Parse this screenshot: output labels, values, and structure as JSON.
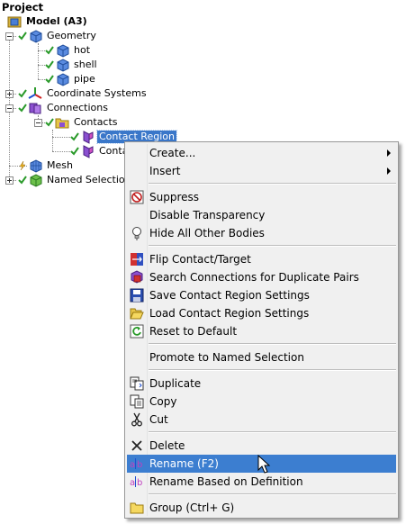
{
  "tree": {
    "title": "Project",
    "nodes": [
      {
        "label": "Model (A3)",
        "icon": "model-icon"
      },
      {
        "label": "Geometry",
        "icon": "geometry-icon"
      },
      {
        "label": "hot",
        "icon": "body-icon"
      },
      {
        "label": "shell",
        "icon": "body-icon"
      },
      {
        "label": "pipe",
        "icon": "body-icon"
      },
      {
        "label": "Coordinate Systems",
        "icon": "coordinate-systems-icon"
      },
      {
        "label": "Connections",
        "icon": "connections-icon"
      },
      {
        "label": "Contacts",
        "icon": "contacts-folder-icon"
      },
      {
        "label": "Contact Region",
        "icon": "contact-region-icon"
      },
      {
        "label": "Contac",
        "icon": "contact-region-icon"
      },
      {
        "label": "Mesh",
        "icon": "mesh-icon"
      },
      {
        "label": "Named Selections",
        "icon": "named-selections-icon"
      }
    ]
  },
  "context_menu": {
    "items": [
      {
        "label": "Create...",
        "submenu": true
      },
      {
        "label": "Insert",
        "submenu": true
      },
      {
        "label": "Suppress",
        "icon": "suppress-icon"
      },
      {
        "label": "Disable Transparency"
      },
      {
        "label": "Hide All Other Bodies",
        "icon": "lightbulb-icon"
      },
      {
        "label": "Flip Contact/Target",
        "icon": "flip-icon"
      },
      {
        "label": "Search Connections for Duplicate Pairs",
        "icon": "search-duplicates-icon"
      },
      {
        "label": "Save Contact Region Settings",
        "icon": "save-icon"
      },
      {
        "label": "Load Contact Region Settings",
        "icon": "open-folder-icon"
      },
      {
        "label": "Reset to Default",
        "icon": "reset-icon"
      },
      {
        "label": "Promote to Named Selection"
      },
      {
        "label": "Duplicate",
        "icon": "duplicate-icon"
      },
      {
        "label": "Copy",
        "icon": "copy-icon"
      },
      {
        "label": "Cut",
        "icon": "scissors-icon"
      },
      {
        "label": "Delete",
        "icon": "delete-x-icon"
      },
      {
        "label": "Rename (F2)",
        "icon": "rename-icon",
        "highlighted": true
      },
      {
        "label": "Rename Based on Definition",
        "icon": "rename-icon"
      },
      {
        "label": "Group (Ctrl+ G)",
        "icon": "folder-icon"
      }
    ]
  },
  "colors": {
    "highlight": "#3c7ed0",
    "selection": "#3a77c9",
    "menu_bg": "#f0f0f0",
    "check_green": "#2a9a2a"
  }
}
